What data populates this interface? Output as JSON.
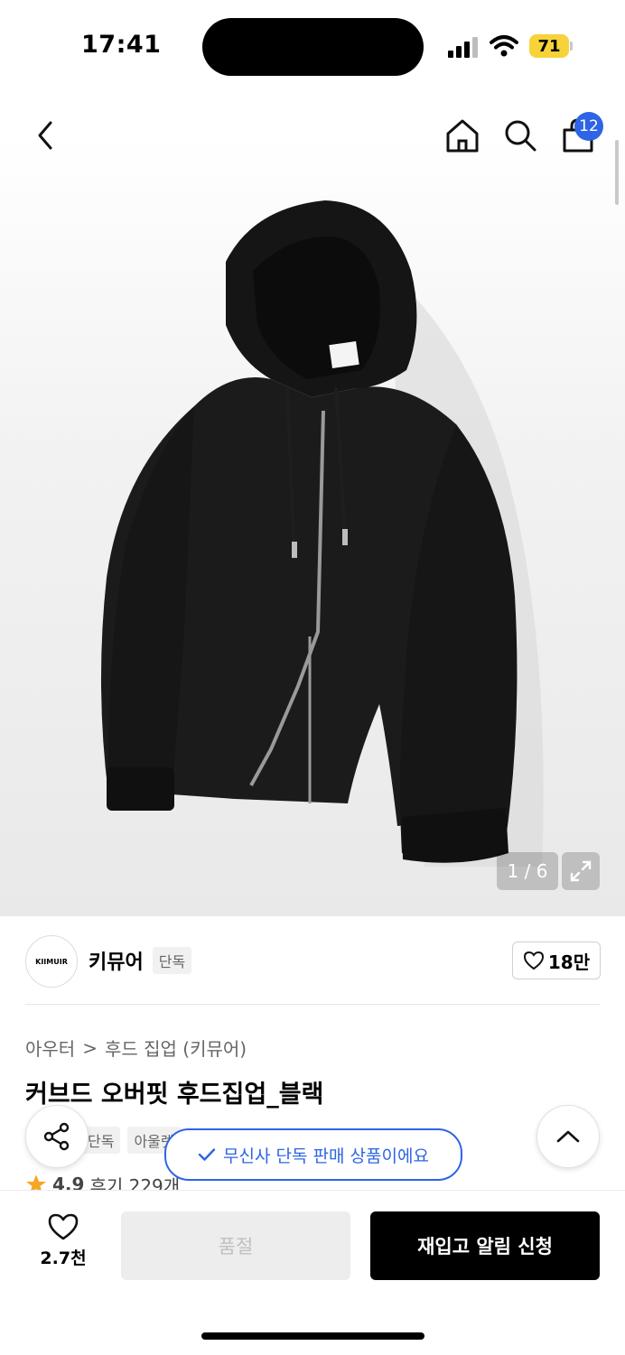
{
  "status_bar": {
    "time": "17:41",
    "battery": "71"
  },
  "header": {
    "cart_count": "12"
  },
  "image": {
    "counter": "1 / 6",
    "brand_label": "KIIMUIR"
  },
  "brand": {
    "logo_text": "KIIMUIR",
    "name": "키뮤어",
    "tag": "단독",
    "likes": "18만"
  },
  "product": {
    "breadcrumb_category": "아우터",
    "breadcrumb_sep": ">",
    "breadcrumb_sub": "후드 집업 (키뮤어)",
    "title": "커브드 오버핏 후드집업_블랙",
    "tags": [
      "단독",
      "아울렛"
    ],
    "rating": "4.9",
    "reviews": "후기 229개"
  },
  "toast": {
    "text": "무신사 단독 판매 상품이에요"
  },
  "bottom": {
    "wish_count": "2.7천",
    "soldout_label": "품절",
    "restock_label": "재입고 알림 신청"
  },
  "colors": {
    "accent_blue": "#2e64e5",
    "badge_blue": "#2e64e5",
    "battery_yellow": "#f7d339",
    "star": "#f5a623"
  }
}
